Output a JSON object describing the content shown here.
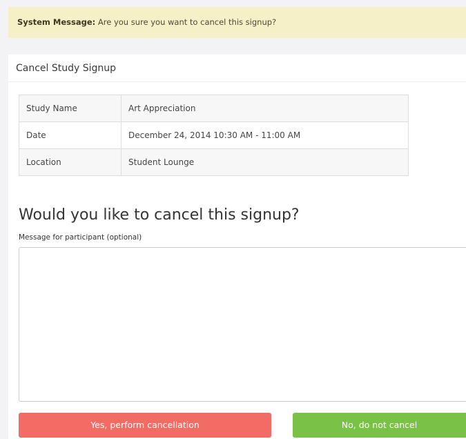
{
  "alert": {
    "label": "System Message:",
    "text": "Are you sure you want to cancel this signup?"
  },
  "panel": {
    "title": "Cancel Study Signup"
  },
  "details": {
    "rows": [
      {
        "key": "Study Name",
        "value": "Art Appreciation"
      },
      {
        "key": "Date",
        "value": "December 24, 2014 10:30 AM - 11:00 AM"
      },
      {
        "key": "Location",
        "value": "Student Lounge"
      }
    ]
  },
  "form": {
    "question": "Would you like to cancel this signup?",
    "message_label": "Message for participant (optional)",
    "message_value": "",
    "yes_label": "Yes, perform cancellation",
    "no_label": "No, do not cancel"
  },
  "colors": {
    "alert_bg": "#f6f0c9",
    "danger": "#f26b64",
    "success": "#79c246"
  }
}
